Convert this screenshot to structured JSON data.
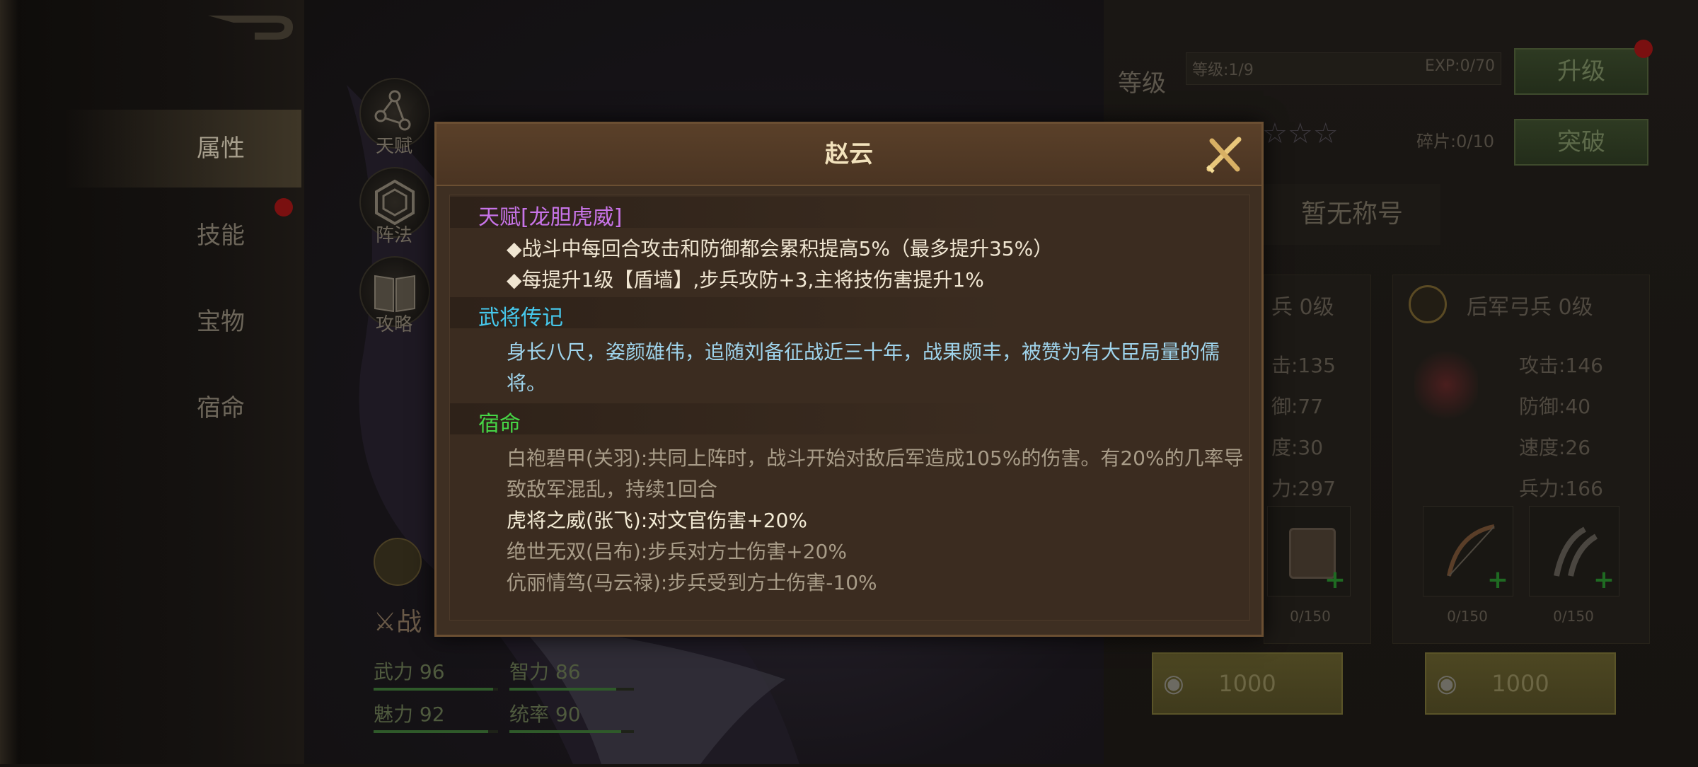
{
  "nav": {
    "items": [
      {
        "label": "属性",
        "active": true
      },
      {
        "label": "技能",
        "badge": true
      },
      {
        "label": "宝物"
      },
      {
        "label": "宿命"
      }
    ]
  },
  "side_buttons": [
    {
      "label": "天赋",
      "icon": "network-icon"
    },
    {
      "label": "阵法",
      "icon": "hexagon-icon"
    },
    {
      "label": "攻略",
      "icon": "book-icon"
    }
  ],
  "hero_stats": [
    {
      "label": "武力 96",
      "fill": 0.96
    },
    {
      "label": "智力 86",
      "fill": 0.86
    },
    {
      "label": "魅力 92",
      "fill": 0.92
    },
    {
      "label": "统率 90",
      "fill": 0.9
    }
  ],
  "battle_label": "战",
  "right": {
    "level_label": "等级",
    "level_value": "等级:1/9",
    "exp_value": "EXP:0/70",
    "upgrade_button": "升级",
    "fragment_value": "碎片:0/10",
    "breakthrough_button": "突破",
    "title_text": "暂无称号",
    "troop_left": {
      "name_partial": "兵 0级",
      "stats": [
        "击:135",
        "御:77",
        "度:30",
        "力:297"
      ],
      "equip_count": "0/150",
      "cost": "1000"
    },
    "troop_right": {
      "name": "后军弓兵 0级",
      "stats": [
        "攻击:146",
        "防御:40",
        "速度:26",
        "兵力:166"
      ],
      "equip_counts": [
        "0/150",
        "0/150"
      ],
      "cost": "1000"
    }
  },
  "modal": {
    "title": "赵云",
    "sections": {
      "talent": {
        "title": "天赋[龙胆虎威]",
        "lines": [
          "◆战斗中每回合攻击和防御都会累积提高5%（最多提升35%）",
          "◆每提升1级【盾墙】,步兵攻防+3,主将技伤害提升1%"
        ]
      },
      "biography": {
        "title": "武将传记",
        "lines": [
          "身长八尺，姿颜雄伟，追随刘备征战近三十年，战果颇丰，被赞为有大臣局量的儒",
          "将。"
        ]
      },
      "destiny": {
        "title": "宿命",
        "lines": [
          "白袍碧甲(关羽):共同上阵时，战斗开始对敌后军造成105%的伤害。有20%的几率导",
          "致敌军混乱，持续1回合",
          "虎将之威(张飞):对文官伤害+20%",
          "绝世无双(吕布):步兵对方士伤害+20%",
          "伉丽情笃(马云禄):步兵受到方士伤害-10%"
        ]
      }
    }
  },
  "colors": {
    "talent_title": "#c874e8",
    "section_title": "#46c8ec",
    "destiny_title": "#46d646",
    "body_text": "#f0e6d2",
    "bio_text": "#9fd4ec",
    "inactive_text": "#a89c88",
    "active_text": "#f4ecd6"
  }
}
